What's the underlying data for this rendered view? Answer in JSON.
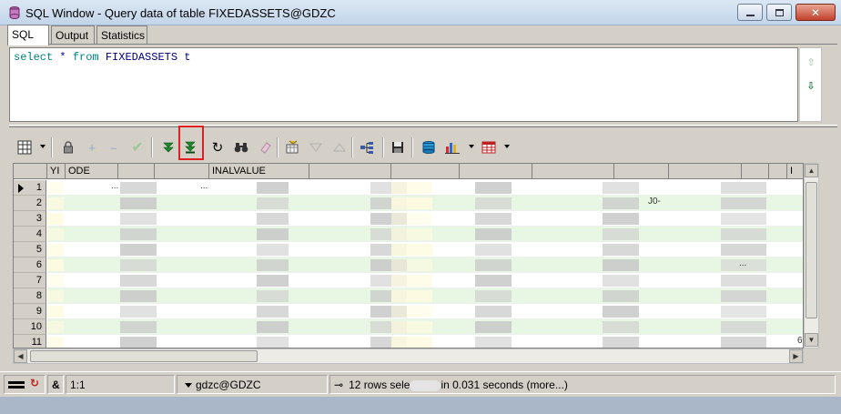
{
  "window": {
    "title": "SQL Window - Query data of table FIXEDASSETS@GDZC",
    "icon": "database-icon"
  },
  "tabs": [
    {
      "label": "SQL",
      "active": true
    },
    {
      "label": "Output",
      "active": false
    },
    {
      "label": "Statistics",
      "active": false
    }
  ],
  "editor": {
    "tokens": [
      {
        "text": "select",
        "kind": "kw"
      },
      {
        "text": " * ",
        "kind": "op"
      },
      {
        "text": "from",
        "kind": "kw"
      },
      {
        "text": " FIXEDASSETS t",
        "kind": "obj"
      }
    ]
  },
  "toolbar": {
    "icons": [
      "grid-layout-icon",
      "lock-icon",
      "plus-icon",
      "minus-icon",
      "check-icon",
      "fetch-next-icon",
      "fetch-last-icon",
      "refresh-icon",
      "binoculars-icon",
      "eraser-icon",
      "query-by-example-icon",
      "filter-down-icon",
      "filter-up-icon",
      "tree-structure-icon",
      "save-icon",
      "export-db-icon",
      "chart-icon",
      "table-icon"
    ],
    "highlighted": "fetch-last-icon"
  },
  "grid": {
    "columns": [
      "",
      "YI",
      "ODE",
      "",
      "",
      "INALVALUE",
      "",
      "",
      "",
      "",
      "",
      "",
      "",
      "",
      "I"
    ],
    "rows": [
      "1",
      "2",
      "3",
      "4",
      "5",
      "6",
      "7",
      "8",
      "9",
      "10",
      "11"
    ],
    "current_row": "1",
    "fragments": [
      {
        "row": 1,
        "text": "..."
      },
      {
        "row": 1,
        "text": "..."
      },
      {
        "row": 2,
        "text": "J0-"
      },
      {
        "row": 6,
        "text": "..."
      },
      {
        "row": 11,
        "text": "6·"
      }
    ]
  },
  "status": {
    "position": "1:1",
    "ampersand": "&",
    "connection": "gdzc@GDZC",
    "message": "12 rows sele",
    "message_tail": "in 0.031 seconds (more...)"
  }
}
